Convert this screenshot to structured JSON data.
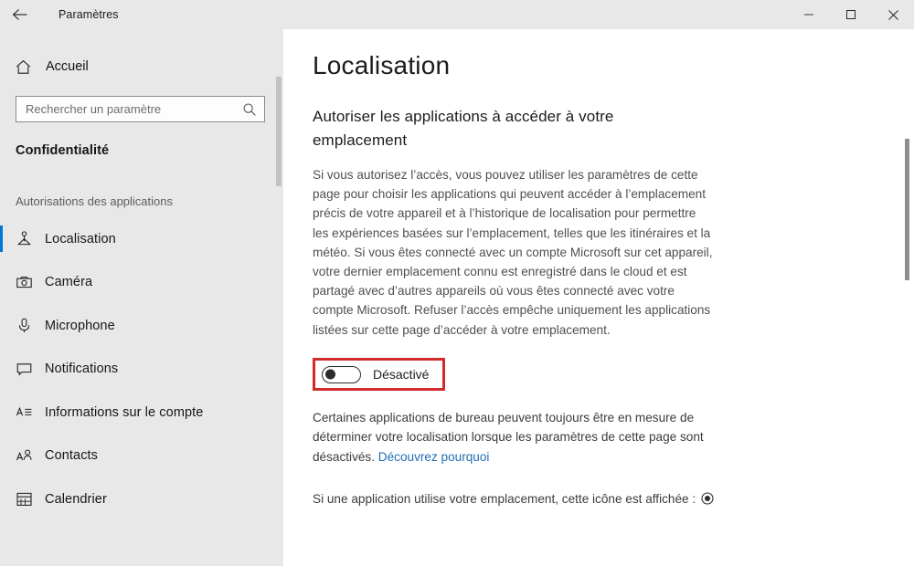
{
  "titlebar": {
    "back_icon": "back-arrow-icon",
    "title": "Paramètres",
    "minimize_label": "—",
    "maximize_label": "□",
    "close_label": "✕"
  },
  "sidebar": {
    "home": {
      "icon": "home-icon",
      "label": "Accueil"
    },
    "search": {
      "icon": "search-icon",
      "placeholder": "Rechercher un paramètre",
      "value": ""
    },
    "section_title": "Confidentialité",
    "group_label": "Autorisations des applications",
    "items": [
      {
        "icon": "location-pin-icon",
        "label": "Localisation",
        "selected": true
      },
      {
        "icon": "camera-icon",
        "label": "Caméra",
        "selected": false
      },
      {
        "icon": "microphone-icon",
        "label": "Microphone",
        "selected": false
      },
      {
        "icon": "notification-icon",
        "label": "Notifications",
        "selected": false
      },
      {
        "icon": "account-info-icon",
        "label": "Informations sur le compte",
        "selected": false
      },
      {
        "icon": "contacts-icon",
        "label": "Contacts",
        "selected": false
      },
      {
        "icon": "calendar-icon",
        "label": "Calendrier",
        "selected": false
      }
    ]
  },
  "main": {
    "page_title": "Localisation",
    "sub_heading": "Autoriser les applications à accéder à votre emplacement",
    "description": "Si vous autorisez l’accès, vous pouvez utiliser les paramètres de cette page pour choisir les applications qui peuvent accéder à l’emplacement précis de votre appareil et à l’historique de localisation pour permettre les expériences basées sur l’emplacement, telles que les itinéraires et la météo. Si vous êtes connecté avec un compte Microsoft sur cet appareil, votre dernier emplacement connu est enregistré dans le cloud et est partagé avec d’autres appareils où vous êtes connecté avec votre compte Microsoft. Refuser l’accès empêche uniquement les applications listées sur cette page d’accéder à votre emplacement.",
    "toggle": {
      "state_label": "Désactivé",
      "checked": false,
      "highlight_color": "#d32b2b"
    },
    "note_text": "Certaines applications de bureau peuvent toujours être en mesure de déterminer votre localisation lorsque les paramètres de cette page sont désactivés. ",
    "note_link": "Découvrez pourquoi",
    "icon_line": "Si une application utilise votre emplacement, cette icône est affichée : ",
    "icon_line_icon": "location-active-icon"
  },
  "colors": {
    "accent": "#0078d7",
    "link": "#1f6fb5",
    "sidebar_bg": "#e8e8e8",
    "content_bg": "#ffffff",
    "highlight_red": "#d32b2b"
  }
}
